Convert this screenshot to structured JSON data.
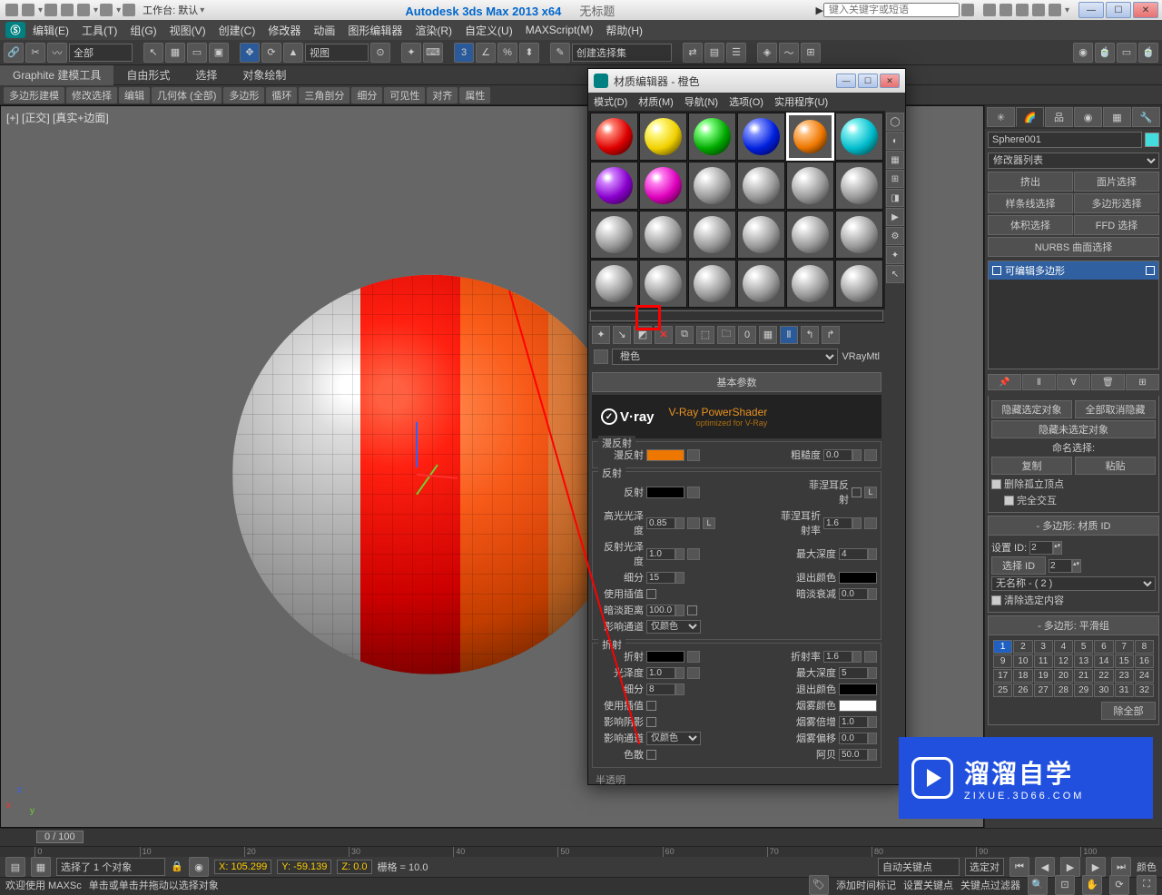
{
  "app": {
    "title": "Autodesk 3ds Max  2013 x64",
    "untitled": "无标题",
    "workspace_label": "工作台: 默认",
    "search_placeholder": "键入关键字或短语"
  },
  "winbuttons": {
    "min": "—",
    "max": "☐",
    "close": "✕"
  },
  "menus": [
    "编辑(E)",
    "工具(T)",
    "组(G)",
    "视图(V)",
    "创建(C)",
    "修改器",
    "动画",
    "图形编辑器",
    "渲染(R)",
    "自定义(U)",
    "MAXScript(M)",
    "帮助(H)"
  ],
  "toolbar": {
    "all_label": "全部",
    "view_label": "视图",
    "create_set": "创建选择集"
  },
  "ribbon": {
    "tabs": [
      "Graphite 建模工具",
      "自由形式",
      "选择",
      "对象绘制"
    ],
    "sub": [
      "多边形建模",
      "修改选择",
      "编辑",
      "几何体 (全部)",
      "多边形",
      "循环",
      "三角剖分",
      "细分",
      "可见性",
      "对齐",
      "属性"
    ]
  },
  "viewport": {
    "label": "[+] [正交] [真实+边面]"
  },
  "cmd": {
    "obj_name": "Sphere001",
    "modlist_label": "修改器列表",
    "buttons": [
      "挤出",
      "面片选择",
      "样条线选择",
      "多边形选择",
      "体积选择",
      "FFD 选择",
      "NURBS 曲面选择"
    ],
    "stack_item": "可编辑多边形",
    "r1_title": "隐藏选定对象",
    "r1_btn2": "全部取消隐藏",
    "r1_sub": "隐藏未选定对象",
    "name_sel": "命名选择:",
    "copy": "复制",
    "paste": "粘贴",
    "del_iso": "删除孤立顶点",
    "full_inter": "完全交互",
    "polyid_title": "多边形: 材质 ID",
    "set_id": "设置 ID:",
    "sel_id": "选择 ID",
    "id_val": "2",
    "noname": "无名称 - ( 2 )",
    "clear_sel": "清除选定内容",
    "smooth_title": "多边形: 平滑组",
    "clear_all": "除全部"
  },
  "mat": {
    "title": "材质编辑器 - 橙色",
    "menus": [
      "模式(D)",
      "材质(M)",
      "导航(N)",
      "选项(O)",
      "实用程序(U)"
    ],
    "name": "橙色",
    "type": "VRayMtl",
    "basic": "基本参数",
    "vray_brand": "V·ray",
    "vray_title": "V-Ray PowerShader",
    "vray_sub": "optimized for V-Ray",
    "diffuse_grp": "漫反射",
    "diffuse": "漫反射",
    "rough": "粗糙度",
    "reflect_grp": "反射",
    "reflect": "反射",
    "hilight": "高光光泽度",
    "reflgloss": "反射光泽度",
    "subdiv": "细分",
    "useinterp": "使用插值",
    "dimdist": "暗淡距离",
    "affect": "影响通道",
    "onlycolor": "仅颜色",
    "fresnel": "菲涅耳反射",
    "fresnelior": "菲涅耳折射率",
    "maxdepth": "最大深度",
    "exitcolor": "退出颜色",
    "dimfall": "暗淡衰减",
    "refract_grp": "折射",
    "refract": "折射",
    "ior": "折射率",
    "gloss": "光泽度",
    "affectshadow": "影响阴影",
    "dispersion": "色散",
    "fogcolor": "烟雾颜色",
    "fogmult": "烟雾倍增",
    "fogbias": "烟雾偏移",
    "abbe": "阿贝",
    "translucency": "半透明",
    "vals": {
      "rough": "0.0",
      "hilight": "0.85",
      "reflgloss": "1.0",
      "subdiv": "15",
      "fresnelior": "1.6",
      "maxdepth_r": "4",
      "dimdist": "100.0",
      "dimfall": "0.0",
      "ior": "1.6",
      "gloss": "1.0",
      "subdiv2": "8",
      "maxdepth_f": "5",
      "fogmult": "1.0",
      "fogbias": "0.0",
      "abbe": "50.0"
    }
  },
  "footer": {
    "frame": "0 / 100",
    "sel_text": "选择了 1 个对象",
    "prompt": "单击或单击并拖动以选择对象",
    "x": "X: 105.299",
    "y": "Y: -59.139",
    "z": "Z: 0.0",
    "grid": "栅格 = 10.0",
    "addtime": "添加时间标记",
    "autokey": "自动关键点",
    "selkey": "选定对",
    "setkey": "设置关键点",
    "keyfilter": "关键点过滤器",
    "welcome": "欢迎使用  MAXSc",
    "color_lbl": "颜色"
  },
  "watermark": {
    "big": "溜溜自学",
    "small": "ZIXUE.3D66.COM"
  }
}
